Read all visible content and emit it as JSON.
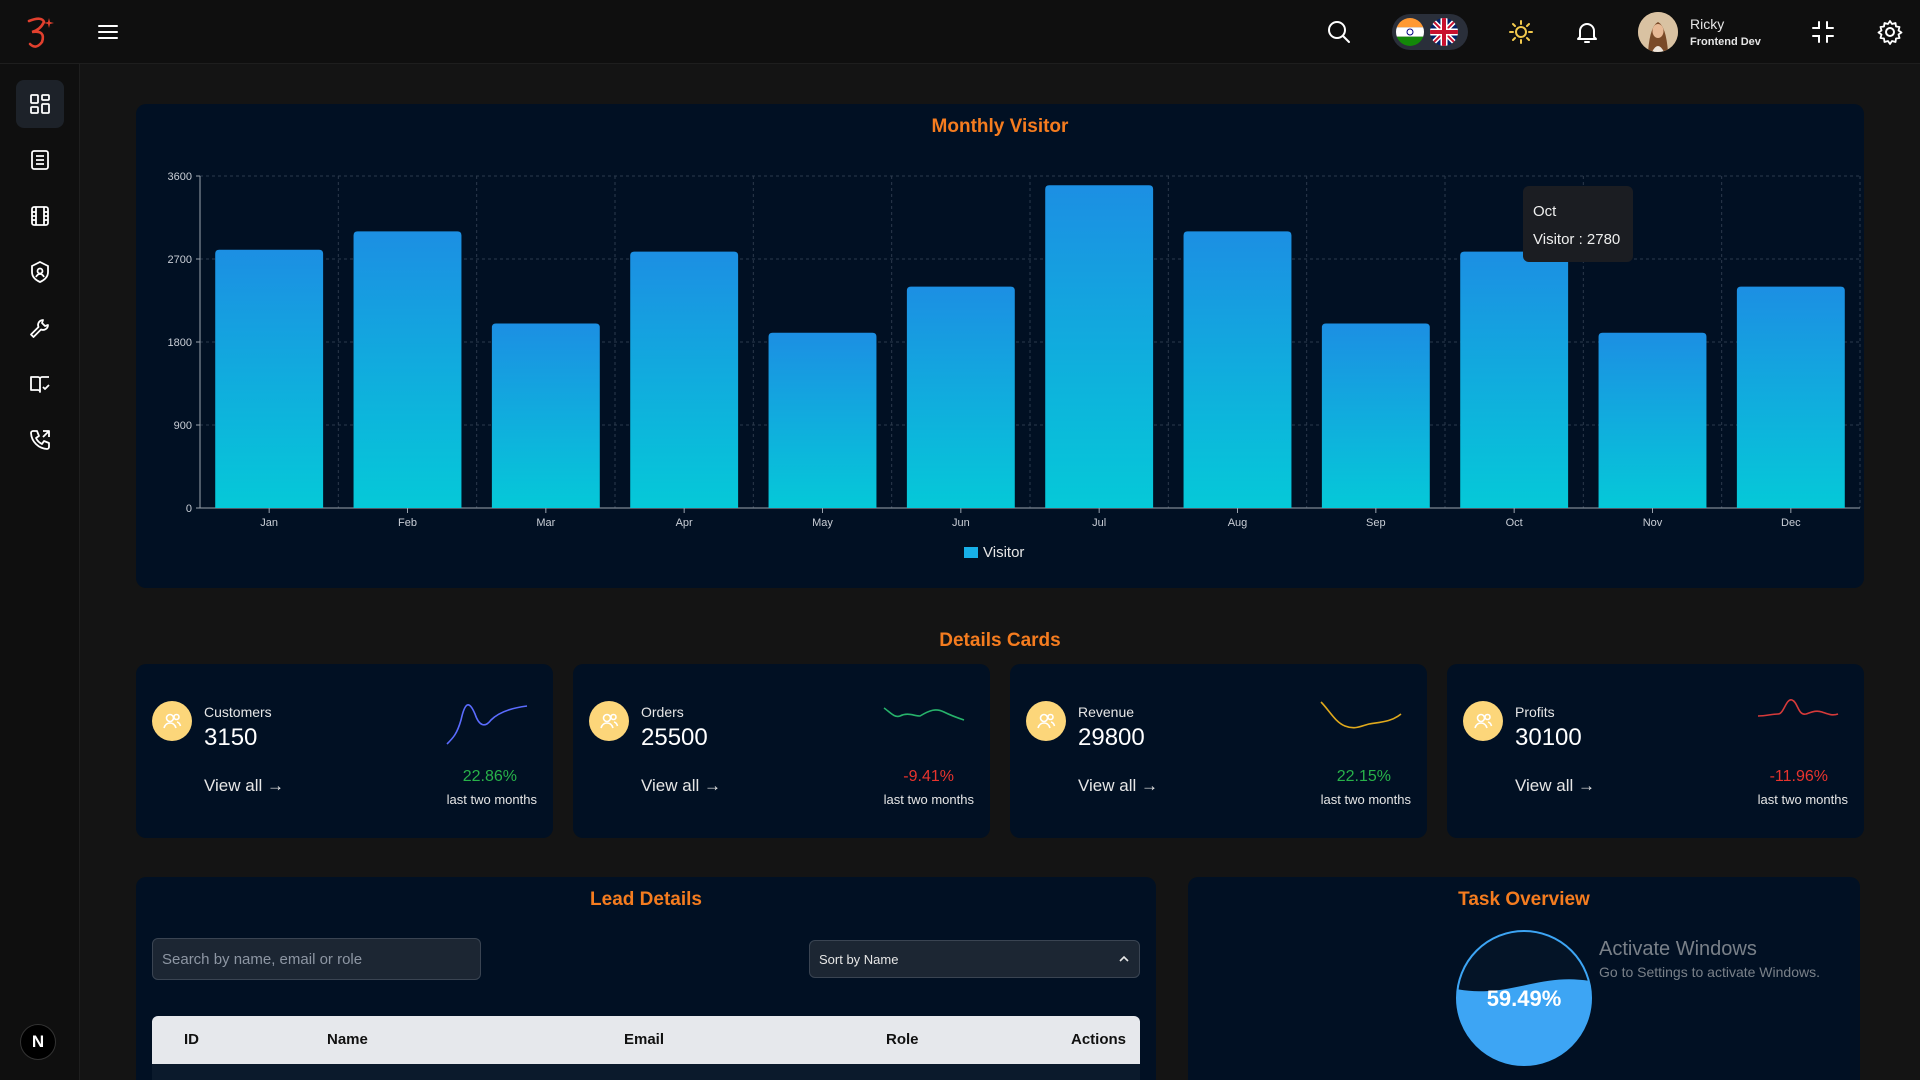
{
  "header": {
    "user_name": "Ricky",
    "user_role": "Frontend Dev",
    "lang_options": [
      "India",
      "United Kingdom"
    ]
  },
  "icons": {
    "logo": "brand-logo",
    "menu": "hamburger-icon",
    "search": "search-icon",
    "theme": "sun-icon",
    "notifications": "bell-icon",
    "fullscreen": "collapse-icon",
    "settings": "gear-icon"
  },
  "sidebar": {
    "items": [
      {
        "name": "dashboard-icon",
        "active": true
      },
      {
        "name": "list-icon"
      },
      {
        "name": "film-icon"
      },
      {
        "name": "shield-icon"
      },
      {
        "name": "wrench-icon"
      },
      {
        "name": "book-check-icon"
      },
      {
        "name": "phone-icon"
      }
    ],
    "badge_letter": "N"
  },
  "chart_panel": {
    "title": "Monthly Visitor",
    "tooltip": {
      "month": "Oct",
      "text": "Visitor : 2780"
    }
  },
  "chart_data": {
    "type": "bar",
    "title": "Monthly Visitor",
    "categories": [
      "Jan",
      "Feb",
      "Mar",
      "Apr",
      "May",
      "Jun",
      "Jul",
      "Aug",
      "Sep",
      "Oct",
      "Nov",
      "Dec"
    ],
    "series": [
      {
        "name": "Visitor",
        "values": [
          2800,
          3000,
          2000,
          2780,
          1900,
          2400,
          3500,
          3000,
          2000,
          2780,
          1900,
          2400
        ]
      }
    ],
    "yticks": [
      0,
      900,
      1800,
      2700,
      3600
    ],
    "ylim": [
      0,
      3600
    ],
    "grid": true,
    "legend": "bottom-center",
    "colors": {
      "top": "#1c8fe3",
      "bottom": "#05c9d8"
    }
  },
  "details": {
    "title": "Details Cards",
    "cards": [
      {
        "label": "Customers",
        "value": "3150",
        "link": "View all →",
        "pct": "22.86%",
        "sub": "last two months",
        "trend": "up",
        "spark_color": "#5b6cff"
      },
      {
        "label": "Orders",
        "value": "25500",
        "link": "View all →",
        "pct": "-9.41%",
        "sub": "last two months",
        "trend": "down",
        "spark_color": "#27b36b"
      },
      {
        "label": "Revenue",
        "value": "29800",
        "link": "View all →",
        "pct": "22.15%",
        "sub": "last two months",
        "trend": "up",
        "spark_color": "#e0a91c"
      },
      {
        "label": "Profits",
        "value": "30100",
        "link": "View all →",
        "pct": "-11.96%",
        "sub": "last two months",
        "trend": "down",
        "spark_color": "#d63a3a"
      }
    ],
    "up_color": "#28b24a",
    "down_color": "#e8342e"
  },
  "leads": {
    "title": "Lead Details",
    "search_placeholder": "Search by name, email or role",
    "sort_label": "Sort by Name",
    "columns": [
      "ID",
      "Name",
      "Email",
      "Role",
      "Actions"
    ]
  },
  "tasks": {
    "title": "Task Overview",
    "progress": 0.5949,
    "progress_text": "59.49%"
  },
  "watermark": {
    "line1": "Activate Windows",
    "line2": "Go to Settings to activate Windows."
  }
}
